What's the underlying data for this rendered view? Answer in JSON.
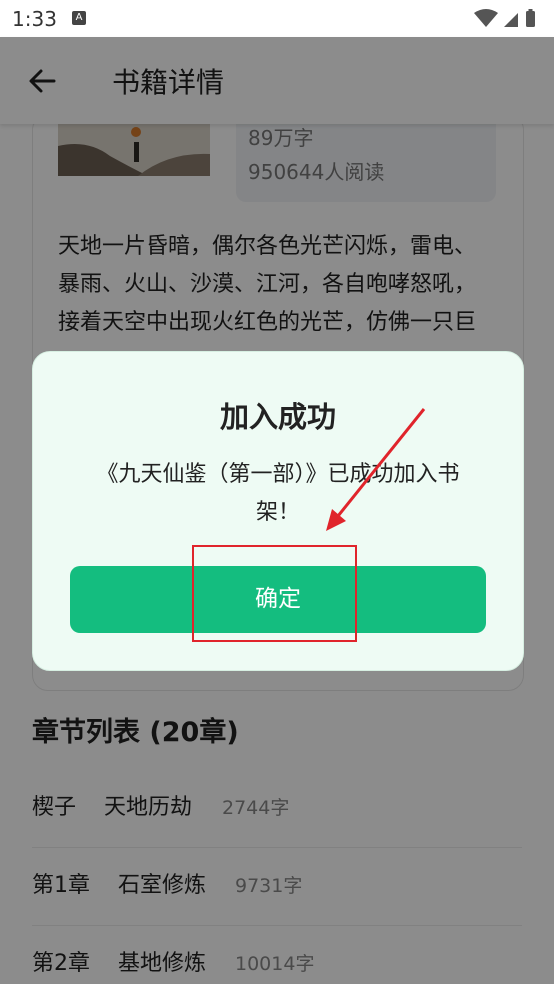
{
  "status_bar": {
    "time": "1:33",
    "notification_badge": "A"
  },
  "app_bar": {
    "title": "书籍详情"
  },
  "book": {
    "word_count": "89万字",
    "readers": "950644人阅读",
    "description": "天地一片昏暗，偶尔各色光芒闪烁，雷电、暴雨、火山、沙漠、江河，各自咆哮怒吼，接着天空中出现火红色的光芒，仿佛一只巨鸟从天而降，落在地面……"
  },
  "chapters": {
    "heading": "章节列表 (20章)",
    "items": [
      {
        "num": "楔子",
        "title": "天地历劫",
        "words": "2744字"
      },
      {
        "num": "第1章",
        "title": "石室修炼",
        "words": "9731字"
      },
      {
        "num": "第2章",
        "title": "基地修炼",
        "words": "10014字"
      }
    ]
  },
  "dialog": {
    "title": "加入成功",
    "message": "《九天仙鉴（第一部）》已成功加入书架！",
    "confirm_label": "确定"
  },
  "colors": {
    "accent": "#14bd7f",
    "annotation": "#e0242b",
    "dialog_bg": "#eefbf4"
  }
}
